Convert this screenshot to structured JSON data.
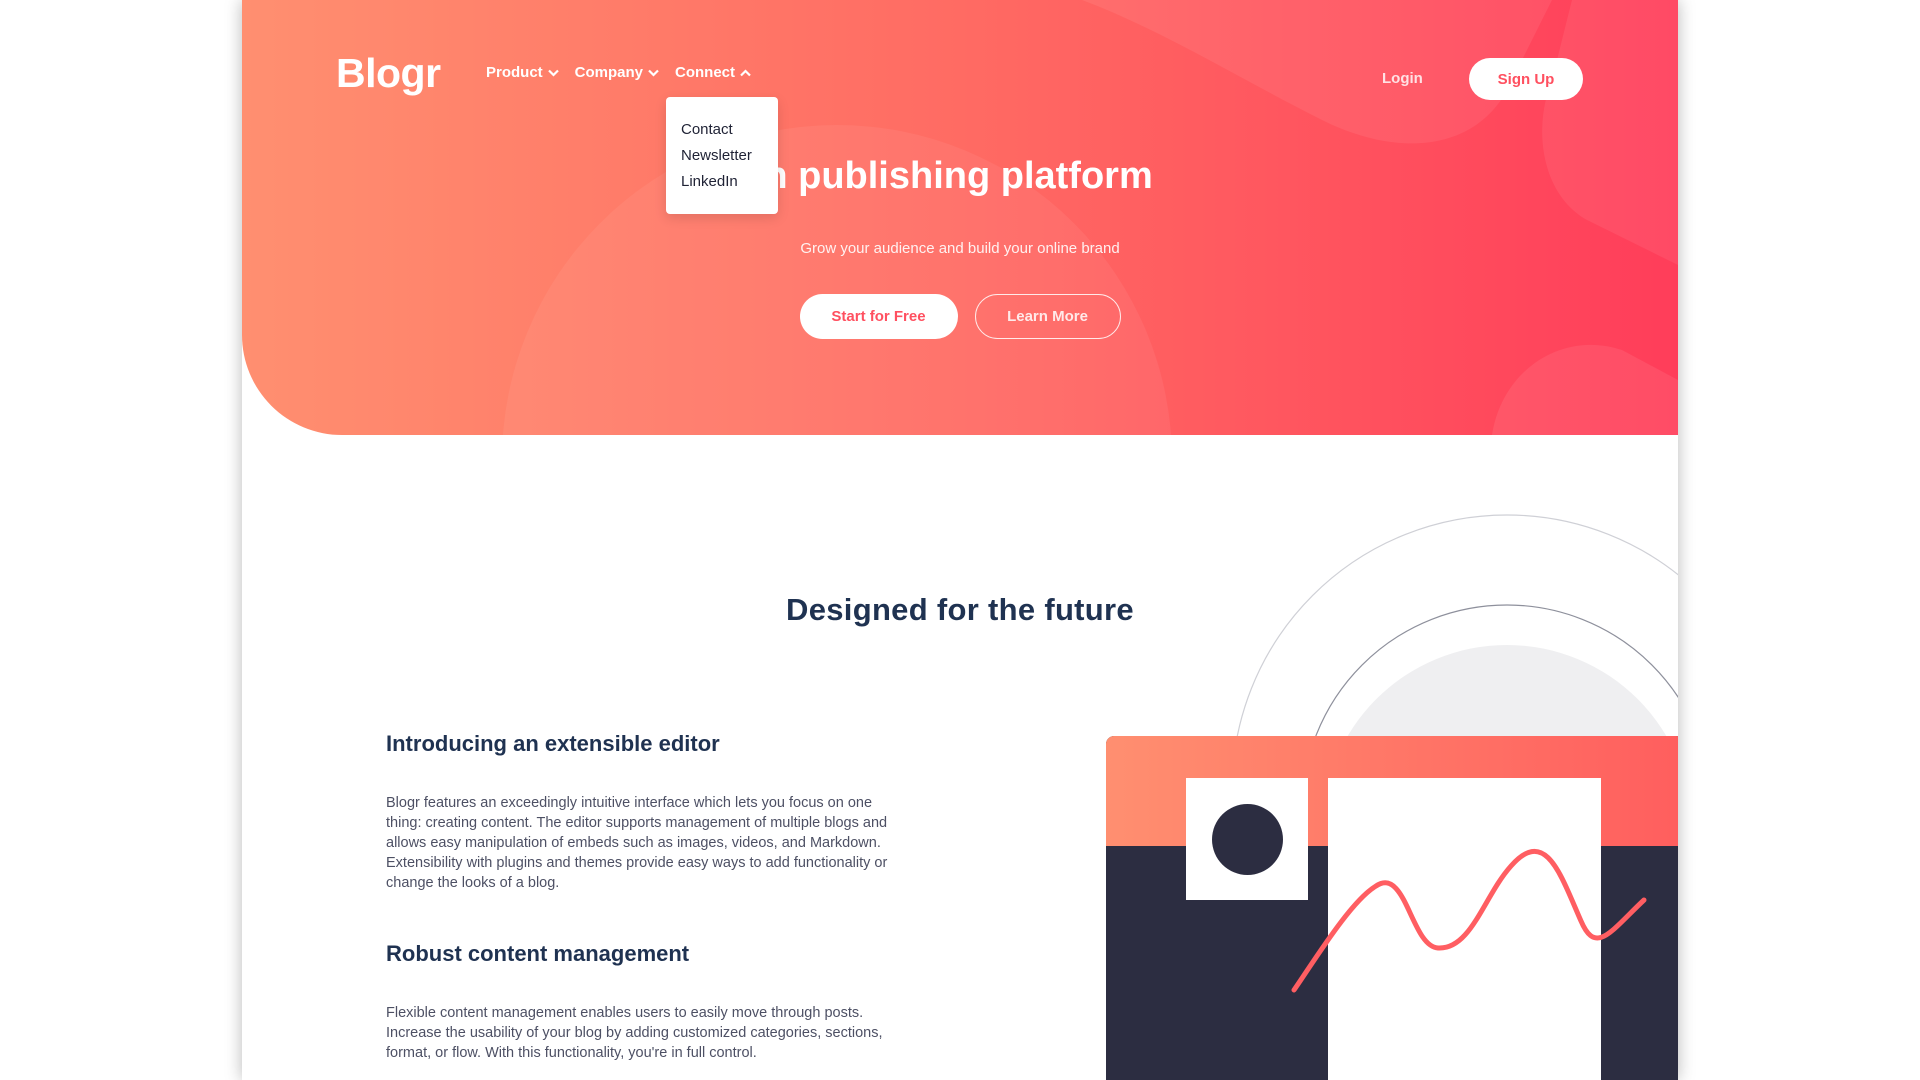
{
  "header": {
    "logo": "Blogr",
    "nav": [
      {
        "label": "Product",
        "state": "collapsed"
      },
      {
        "label": "Company",
        "state": "collapsed"
      },
      {
        "label": "Connect",
        "state": "expanded"
      }
    ],
    "connect_menu": [
      "Contact",
      "Newsletter",
      "LinkedIn"
    ],
    "login_label": "Login",
    "signup_label": "Sign Up"
  },
  "hero": {
    "title_visible": "odern publishing platform",
    "subtitle": "Grow your audience and build your online brand",
    "primary_cta": "Start for Free",
    "secondary_cta": "Learn More"
  },
  "section": {
    "title": "Designed for the future"
  },
  "features": [
    {
      "heading": "Introducing an extensible editor",
      "body": "Blogr features an exceedingly intuitive interface which lets you focus on one thing: creating content. The editor supports management of multiple blogs and allows easy manipulation of embeds such as images, videos, and Markdown. Extensibility with plugins and themes provide easy ways to add functionality or change the looks of a blog."
    },
    {
      "heading": "Robust content management",
      "body": "Flexible content management enables users to easily move through posts. Increase the usability of your blog by adding customized categories, sections, format, or flow. With this functionality, you're in full control."
    }
  ],
  "icons": {
    "chevron_down": "chevron-down-icon",
    "chevron_up": "chevron-up-icon"
  },
  "colors": {
    "brand_red": "#ff5060",
    "gradient_start": "#ff8f70",
    "gradient_end": "#ff3d5a",
    "heading_navy": "#1f3251",
    "illustration_dark": "#2c2d41"
  }
}
